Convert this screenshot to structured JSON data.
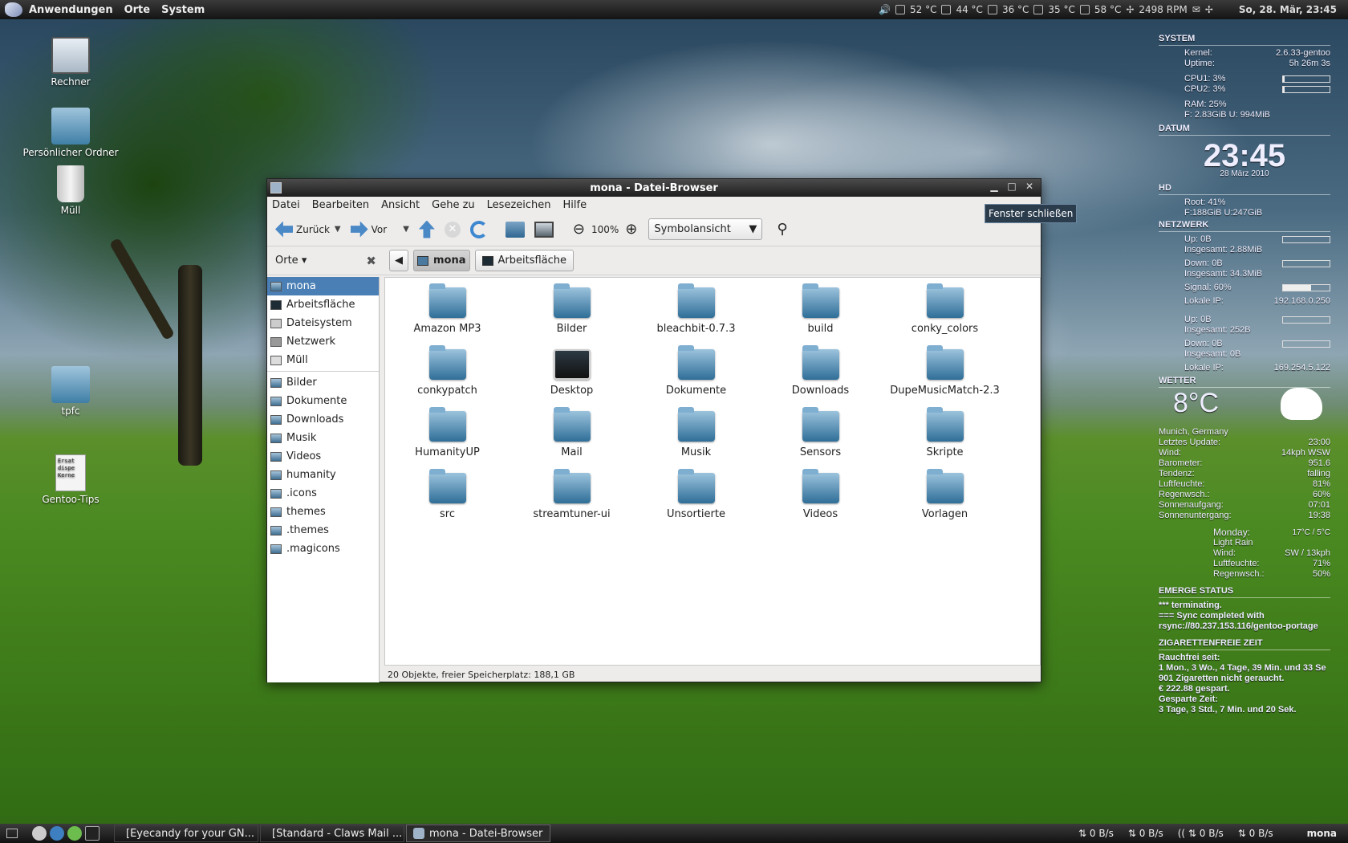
{
  "topbar": {
    "menu": [
      "Anwendungen",
      "Orte",
      "System"
    ],
    "sensors": [
      "52 °C",
      "44 °C",
      "36 °C",
      "35 °C",
      "58 °C",
      "2498 RPM"
    ],
    "clock": "So, 28. Mär, 23:45"
  },
  "desktop": {
    "icons": [
      "Rechner",
      "Persönlicher Ordner",
      "Müll",
      "tpfc",
      "Gentoo-Tips"
    ],
    "doc_lines": [
      "Ersat",
      "dispe",
      "Kerne"
    ]
  },
  "window": {
    "title": "mona - Datei-Browser",
    "menu": [
      "Datei",
      "Bearbeiten",
      "Ansicht",
      "Gehe zu",
      "Lesezeichen",
      "Hilfe"
    ],
    "toolbar": {
      "back": "Zurück",
      "forward": "Vor",
      "zoom": "100%",
      "view": "Symbolansicht"
    },
    "places_header": "Orte",
    "path": [
      "mona",
      "Arbeitsfläche"
    ],
    "places": [
      "mona",
      "Arbeitsfläche",
      "Dateisystem",
      "Netzwerk",
      "Müll"
    ],
    "bookmarks": [
      "Bilder",
      "Dokumente",
      "Downloads",
      "Musik",
      "Videos",
      "humanity",
      ".icons",
      "themes",
      ".themes",
      ".magicons"
    ],
    "files": [
      "Amazon MP3",
      "Bilder",
      "bleachbit-0.7.3",
      "build",
      "conky_colors",
      "conkypatch",
      "Desktop",
      "Dokumente",
      "Downloads",
      "DupeMusicMatch-2.3",
      "HumanityUP",
      "Mail",
      "Musik",
      "Sensors",
      "Skripte",
      "src",
      "streamtuner-ui",
      "Unsortierte",
      "Videos",
      "Vorlagen"
    ],
    "status": "20 Objekte, freier Speicherplatz: 188,1 GB"
  },
  "tooltip": "Fenster schließen",
  "conky": {
    "system": {
      "header": "SYSTEM",
      "kernel_l": "Kernel:",
      "kernel_v": "2.6.33-gentoo",
      "uptime_l": "Uptime:",
      "uptime_v": "5h 26m 3s",
      "cpu1": "CPU1: 3%",
      "cpu2": "CPU2: 3%",
      "cpu1_fill": 0.03,
      "cpu2_fill": 0.03,
      "ram": "RAM: 25%",
      "ram_detail": "F: 2.83GiB U: 994MiB"
    },
    "datum": {
      "header": "DATUM",
      "time": "23:45",
      "date": "28 März 2010"
    },
    "hd": {
      "header": "HD",
      "root": "Root: 41%",
      "detail": "F:188GiB U:247GiB"
    },
    "netz": {
      "header": "NETZWERK",
      "up1": "Up: 0B",
      "up1_total": "Insgesamt: 2.88MiB",
      "down1": "Down: 0B",
      "down1_total": "Insgesamt: 34.3MiB",
      "signal": "Signal: 60%",
      "signal_fill": 0.6,
      "ip1_l": "Lokale IP:",
      "ip1_v": "192.168.0.250",
      "up2": "Up: 0B",
      "up2_total": "Insgesamt: 252B",
      "down2": "Down: 0B",
      "down2_total": "Insgesamt: 0B",
      "ip2_l": "Lokale IP:",
      "ip2_v": "169.254.5.122"
    },
    "wetter": {
      "header": "WETTER",
      "temp": "8°C",
      "rows": [
        [
          "Munich, Germany",
          ""
        ],
        [
          "Letztes Update:",
          "23:00"
        ],
        [
          "Wind:",
          "14kph WSW"
        ],
        [
          "Barometer:",
          "951.6"
        ],
        [
          "Tendenz:",
          "falling"
        ],
        [
          "Luftfeuchte:",
          "81%"
        ],
        [
          "Regenwsch.:",
          "60%"
        ],
        [
          "Sonnenaufgang:",
          "07:01"
        ],
        [
          "Sonnenuntergang:",
          "19:38"
        ]
      ],
      "fc_day": "Monday:",
      "fc_temp": "17°C / 5°C",
      "fc_rows": [
        [
          "Light Rain",
          ""
        ],
        [
          "Wind:",
          "SW / 13kph"
        ],
        [
          "Luftfeuchte:",
          "71%"
        ],
        [
          "Regenwsch.:",
          "50%"
        ]
      ]
    },
    "emerge": {
      "header": "EMERGE STATUS",
      "lines": [
        "*** terminating.",
        "=== Sync completed with",
        "rsync://80.237.153.116/gentoo-portage"
      ]
    },
    "zig": {
      "header": "ZIGARETTENFREIE ZEIT",
      "lines": [
        "Rauchfrei seit:",
        "1 Mon., 3 Wo., 4 Tage, 39 Min. und 33 Se",
        "901 Zigaretten nicht geraucht.",
        "€ 222.88 gespart.",
        "Gesparte Zeit:",
        "3 Tage, 3 Std., 7 Min. und 20 Sek."
      ]
    }
  },
  "taskbar": {
    "tasks": [
      "[Eyecandy for your GN...",
      "[Standard - Claws Mail ...",
      "mona - Datei-Browser"
    ],
    "tray": [
      "0 B/s",
      "0 B/s",
      "0 B/s",
      "0 B/s"
    ],
    "user": "mona"
  }
}
